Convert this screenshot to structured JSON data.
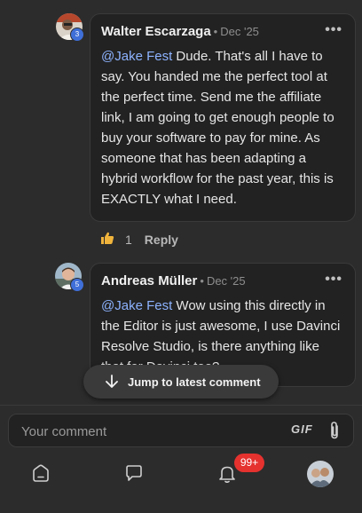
{
  "comments": [
    {
      "author": "Walter Escarzaga",
      "date": "Dec '25",
      "level": "3",
      "mention": "@Jake Fest",
      "text_lines": [
        " Dude. That's all I have to",
        "say. You handed me the perfect tool at",
        "the perfect time. Send me the affiliate",
        "link, I am going to get enough people to",
        "buy your software to pay for mine. As",
        "someone that has been adapting a",
        "hybrid workflow for the past year, this is",
        "EXACTLY what I need."
      ],
      "likes": "1",
      "reply_label": "Reply",
      "more_label": "•••"
    },
    {
      "author": "Andreas Müller",
      "date": "Dec '25",
      "level": "5",
      "mention": "@Jake Fest",
      "text_lines": [
        " Wow using this directly in",
        "the Editor is just awesome, I use Davinci",
        "Resolve Studio, is there anything like",
        "that for Davinci too?"
      ],
      "more_label": "•••"
    }
  ],
  "separator_dot": "•",
  "jump_button": {
    "label": "Jump to latest comment"
  },
  "composer": {
    "placeholder": "Your comment",
    "gif_label": "GIF"
  },
  "navbar": {
    "notification_badge": "99+",
    "icons": [
      "home-icon",
      "chat-icon",
      "bell-icon",
      "profile-avatar"
    ]
  },
  "colors": {
    "background": "#2c2c2c",
    "bubble": "#222222",
    "mention": "#8db3ff",
    "badge_red": "#e5322f",
    "level_blue": "#3f6fd8"
  }
}
